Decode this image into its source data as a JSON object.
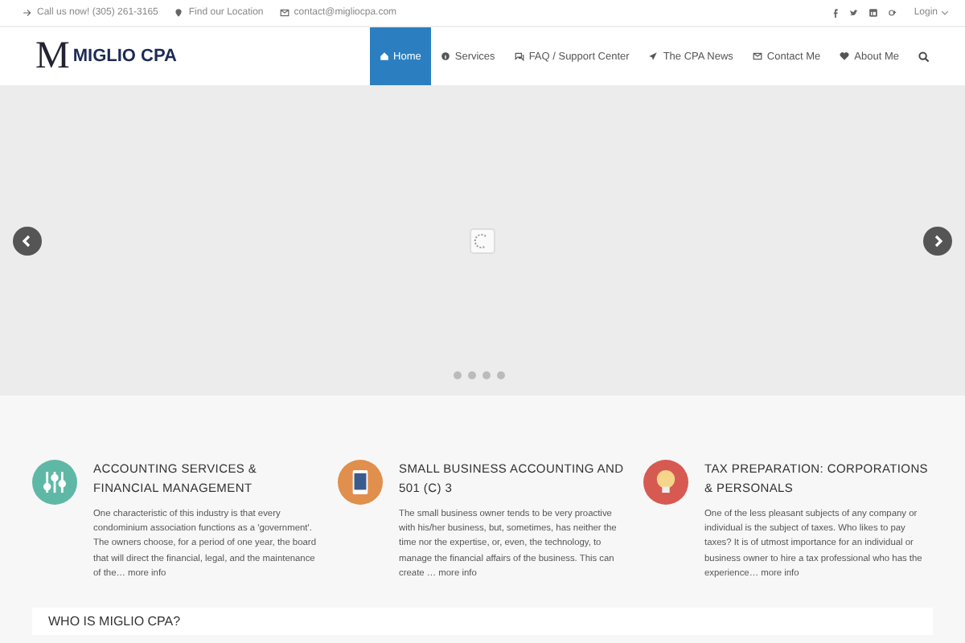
{
  "top_bar": {
    "items": [
      {
        "kind": "arrow",
        "label": "Call us now! (305) 261-3165"
      },
      {
        "kind": "pin",
        "label": "Find our Location"
      },
      {
        "kind": "mail",
        "label": "contact@migliocpa.com"
      }
    ],
    "social": [
      {
        "kind": "facebook"
      },
      {
        "kind": "twitter"
      },
      {
        "kind": "linkedin"
      },
      {
        "kind": "googleplus"
      }
    ],
    "login": "Login"
  },
  "header": {
    "logo_letter": "M",
    "logo_text": "MIGLIO CPA",
    "nav": [
      {
        "kind": "home",
        "label": "Home",
        "selected": true
      },
      {
        "kind": "info",
        "label": "Services",
        "selected": false
      },
      {
        "kind": "chat",
        "label": "FAQ / Support Center",
        "selected": false
      },
      {
        "kind": "plane",
        "label": "The CPA News",
        "selected": false
      },
      {
        "kind": "mail",
        "label": "Contact Me",
        "selected": false
      },
      {
        "kind": "heart",
        "label": "About Me",
        "selected": false
      }
    ]
  },
  "slider": {
    "dots": [
      {
        "selected": false
      },
      {
        "selected": false
      },
      {
        "selected": false
      },
      {
        "selected": false
      }
    ]
  },
  "features": [
    {
      "kind": "sliders",
      "color": "#5fb8a6",
      "title": "ACCOUNTING SERVICES & FINANCIAL MANAGEMENT",
      "text": "One characteristic of this industry is that every condominium association functions as a 'government'. The owners choose, for a period of one year, the board that will direct the financial, legal, and the maintenance of the…",
      "link": "more info"
    },
    {
      "kind": "tablet",
      "color": "#e08f4c",
      "title": "SMALL BUSINESS ACCOUNTING AND 501 (C) 3",
      "text": "The small business owner tends to be very proactive with his/her business, but, sometimes, has neither the time nor the expertise, or, even, the technology, to manage the financial affairs of the business. This can create …",
      "link": "more info"
    },
    {
      "kind": "bulb",
      "color": "#d65a52",
      "title": "TAX PREPARATION: CORPORATIONS & PERSONALS",
      "text": "One of the less pleasant subjects of any company or individual is the subject of taxes. Who likes to pay taxes? It is of utmost importance for an individual or business owner to hire a  tax professional who has the experience…",
      "link": "more info"
    }
  ],
  "about": {
    "heading": "WHO IS MIGLIO CPA?"
  }
}
